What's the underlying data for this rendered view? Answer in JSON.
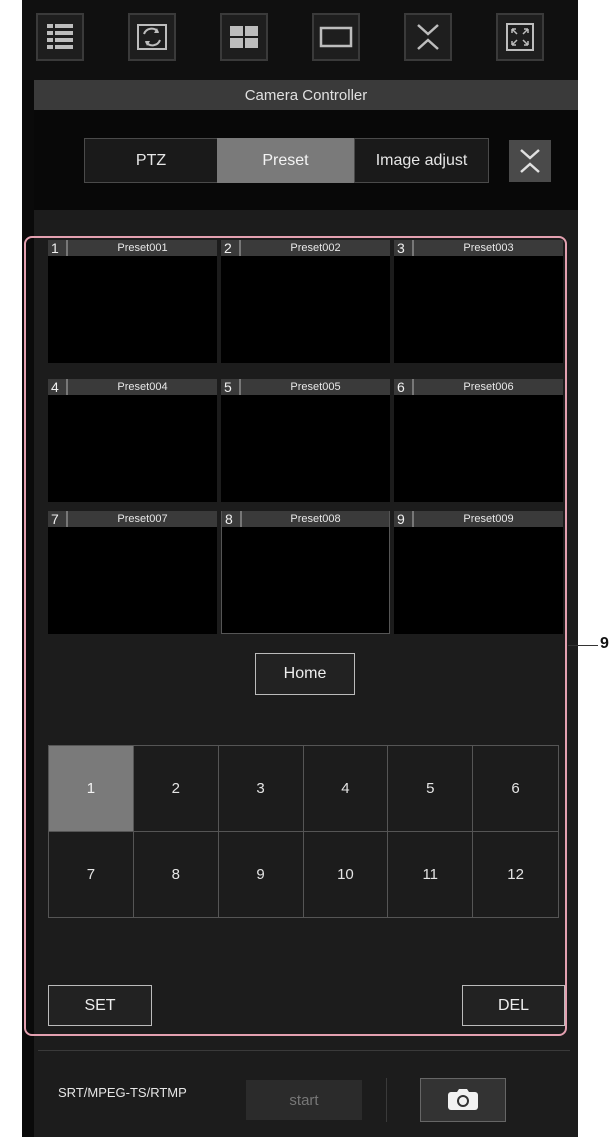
{
  "window": {
    "title": "Camera Controller"
  },
  "toolbar": {
    "buttons": [
      {
        "icon": "list-view-icon"
      },
      {
        "icon": "rotate-image-icon"
      },
      {
        "icon": "quad-view-icon"
      },
      {
        "icon": "single-view-icon"
      },
      {
        "icon": "collapse-icon"
      },
      {
        "icon": "fullscreen-icon"
      }
    ]
  },
  "tabs": [
    {
      "label": "PTZ",
      "active": false
    },
    {
      "label": "Preset",
      "active": true
    },
    {
      "label": "Image adjust",
      "active": false
    }
  ],
  "presets": [
    {
      "num": "1",
      "name": "Preset001"
    },
    {
      "num": "2",
      "name": "Preset002"
    },
    {
      "num": "3",
      "name": "Preset003"
    },
    {
      "num": "4",
      "name": "Preset004"
    },
    {
      "num": "5",
      "name": "Preset005"
    },
    {
      "num": "6",
      "name": "Preset006"
    },
    {
      "num": "7",
      "name": "Preset007"
    },
    {
      "num": "8",
      "name": "Preset008"
    },
    {
      "num": "9",
      "name": "Preset009"
    }
  ],
  "home": {
    "label": "Home"
  },
  "page_grid": {
    "selected": "1",
    "numbers": [
      "1",
      "2",
      "3",
      "4",
      "5",
      "6",
      "7",
      "8",
      "9",
      "10",
      "11",
      "12"
    ]
  },
  "actions": {
    "set_label": "SET",
    "del_label": "DEL"
  },
  "stream": {
    "label": "SRT/MPEG-TS/RTMP",
    "start_label": "start"
  },
  "callout": {
    "label": "9"
  },
  "colors": {
    "selected": "#7a7a7a",
    "highlight": "#e3a0b0"
  }
}
